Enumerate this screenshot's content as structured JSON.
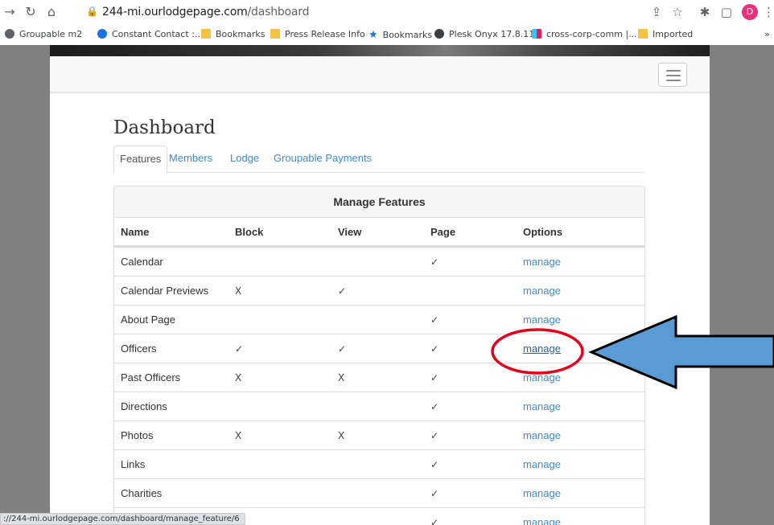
{
  "browser": {
    "url_host": "244-mi.ourlodgepage.com",
    "url_path": "/dashboard",
    "profile_initial": "D",
    "status_url": "://244-mi.ourlodgepage.com/dashboard/manage_feature/6",
    "bookmarks": [
      {
        "label": "Groupable m2",
        "icon": "globe-icon"
      },
      {
        "label": "Constant Contact :...",
        "icon": "constant-contact-icon"
      },
      {
        "label": "Bookmarks",
        "icon": "folder-icon"
      },
      {
        "label": "Press Release Info",
        "icon": "folder-icon"
      },
      {
        "label": "Bookmarks",
        "icon": "star-icon"
      },
      {
        "label": "Plesk Onyx 17.8.11",
        "icon": "plesk-icon"
      },
      {
        "label": "cross-corp-comm |...",
        "icon": "slack-icon"
      },
      {
        "label": "Imported",
        "icon": "folder-icon"
      }
    ],
    "overflow": "»"
  },
  "page": {
    "title": "Dashboard",
    "tabs": [
      {
        "label": "Features",
        "active": true
      },
      {
        "label": "Members",
        "active": false
      },
      {
        "label": "Lodge",
        "active": false
      },
      {
        "label": "Groupable Payments",
        "active": false
      }
    ]
  },
  "panel": {
    "heading": "Manage Features",
    "columns": [
      "Name",
      "Block",
      "View",
      "Page",
      "Options"
    ],
    "rows": [
      {
        "name": "Calendar",
        "block": "",
        "view": "",
        "page": "✓",
        "option": "manage"
      },
      {
        "name": "Calendar Previews",
        "block": "X",
        "view": "✓",
        "page": "",
        "option": "manage"
      },
      {
        "name": "About Page",
        "block": "",
        "view": "",
        "page": "✓",
        "option": "manage"
      },
      {
        "name": "Officers",
        "block": "✓",
        "view": "✓",
        "page": "✓",
        "option": "manage"
      },
      {
        "name": "Past Officers",
        "block": "X",
        "view": "X",
        "page": "✓",
        "option": "manage"
      },
      {
        "name": "Directions",
        "block": "",
        "view": "",
        "page": "✓",
        "option": "manage"
      },
      {
        "name": "Photos",
        "block": "X",
        "view": "X",
        "page": "✓",
        "option": "manage"
      },
      {
        "name": "Links",
        "block": "",
        "view": "",
        "page": "✓",
        "option": "manage"
      },
      {
        "name": "Charities",
        "block": "",
        "view": "",
        "page": "✓",
        "option": "manage"
      },
      {
        "name": "",
        "block": "",
        "view": "",
        "page": "✓",
        "option": "manage"
      }
    ]
  },
  "colors": {
    "link": "#428bca",
    "annotation_arrow": "#5b9bd5",
    "annotation_circle": "#e3001b"
  }
}
